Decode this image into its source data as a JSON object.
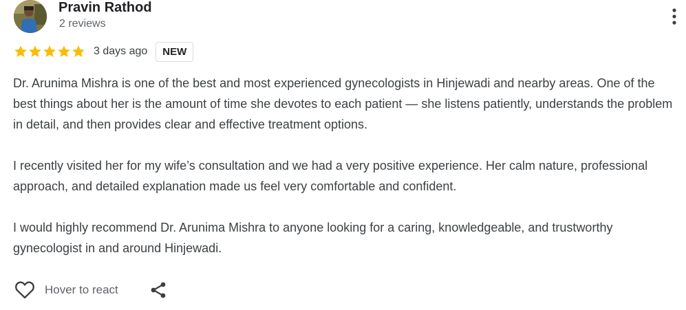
{
  "author": {
    "name": "Pravin Rathod",
    "review_count": "2 reviews"
  },
  "review": {
    "rating": 5,
    "rating_max": 5,
    "date": "3 days ago",
    "badge": "NEW",
    "paragraphs": [
      "Dr. Arunima Mishra is one of the best and most experienced gynecologists in Hinjewadi and nearby areas. One of the best things about her is the amount of time she devotes to each patient — she listens patiently, understands the problem in detail, and then provides clear and effective treatment options.",
      "I recently visited her for my wife’s consultation and we had a very positive experience. Her calm nature, professional approach, and detailed explanation made us feel very comfortable and confident.",
      "I would highly recommend Dr. Arunima Mishra to anyone looking for a caring, knowledgeable, and trustworthy gynecologist in and around Hinjewadi."
    ]
  },
  "actions": {
    "react_label": "Hover to react",
    "icons": [
      "heart-outline-icon",
      "share-icon",
      "more-vertical-icon",
      "star-icon"
    ]
  },
  "colors": {
    "star": "#fbbc04",
    "text": "#3c4043",
    "muted": "#5f6368",
    "badge_border": "#dadce0"
  }
}
